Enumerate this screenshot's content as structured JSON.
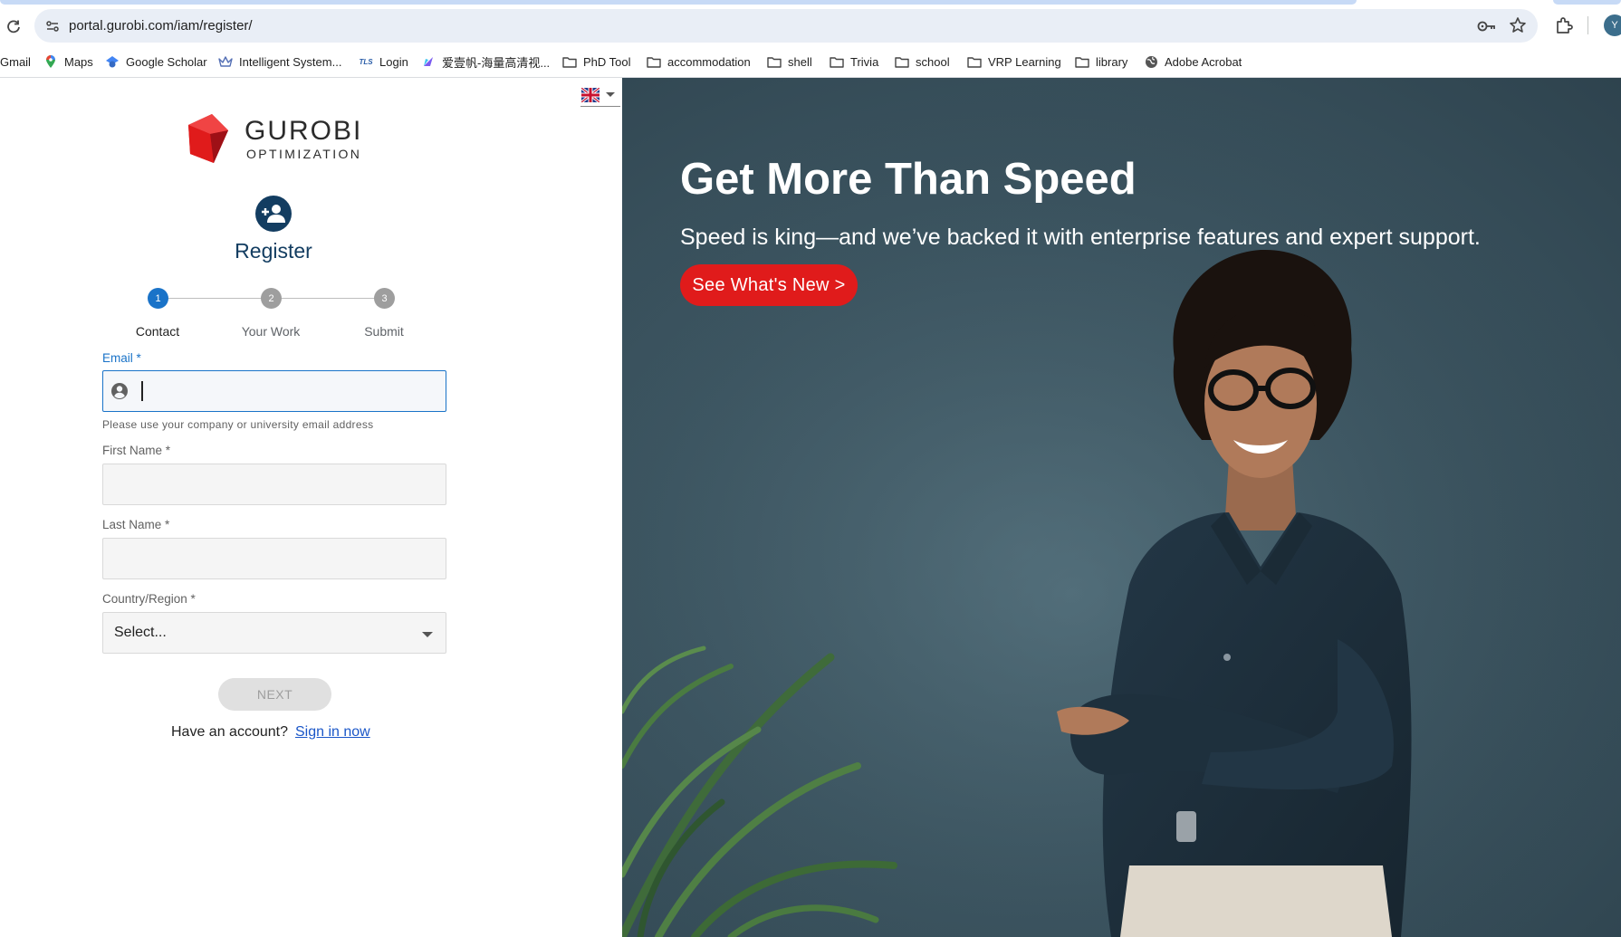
{
  "browser": {
    "url": "portal.gurobi.com/iam/register/",
    "profile_initial": "Y",
    "bookmarks": [
      {
        "label": "Gmail",
        "icon": "gmail-icon"
      },
      {
        "label": "Maps",
        "icon": "maps-pin-icon"
      },
      {
        "label": "Google Scholar",
        "icon": "scholar-icon"
      },
      {
        "label": "Intelligent System...",
        "icon": "crown-icon"
      },
      {
        "label": "Login",
        "icon": "tls-icon"
      },
      {
        "label": "爱壹帆-海量高清视...",
        "icon": "aiyifan-icon"
      },
      {
        "label": "PhD Tool",
        "icon": "folder-icon"
      },
      {
        "label": "accommodation",
        "icon": "folder-icon"
      },
      {
        "label": "shell",
        "icon": "folder-icon"
      },
      {
        "label": "Trivia",
        "icon": "folder-icon"
      },
      {
        "label": "school",
        "icon": "folder-icon"
      },
      {
        "label": "VRP Learning",
        "icon": "folder-icon"
      },
      {
        "label": "library",
        "icon": "folder-icon"
      },
      {
        "label": "Adobe Acrobat",
        "icon": "globe-icon"
      }
    ]
  },
  "logo": {
    "word": "GUROBI",
    "sub": "OPTIMIZATION",
    "color": "#e01b1b"
  },
  "register": {
    "title": "Register"
  },
  "steps": [
    {
      "number": "1",
      "label": "Contact",
      "active": true
    },
    {
      "number": "2",
      "label": "Your Work",
      "active": false
    },
    {
      "number": "3",
      "label": "Submit",
      "active": false
    }
  ],
  "form": {
    "email_label": "Email *",
    "email_value": "",
    "email_help": "Please use your company or university email address",
    "first_name_label": "First Name *",
    "last_name_label": "Last Name *",
    "country_label": "Country/Region *",
    "country_value": "Select...",
    "next_label": "NEXT",
    "have_account": "Have an account?",
    "sign_in": "Sign in now"
  },
  "hero": {
    "title": "Get More Than Speed",
    "subtitle": "Speed is king—and we’ve backed it with enterprise features and expert support.",
    "button": "See What's New >"
  },
  "colors": {
    "accent_blue": "#1a73c8",
    "brand_navy": "#133d61",
    "brand_red": "#e01b1b",
    "hero_bg": "#3d5662"
  }
}
